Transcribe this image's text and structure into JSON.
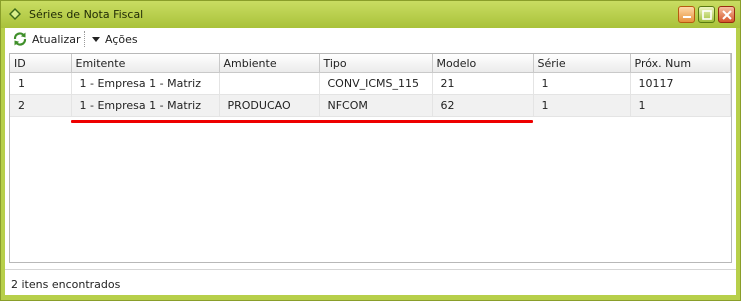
{
  "window": {
    "title": "Séries de Nota Fiscal",
    "accent": "#b7cf4a"
  },
  "toolbar": {
    "refresh_label": "Atualizar",
    "actions_label": "Ações"
  },
  "grid": {
    "columns": [
      "ID",
      "Emitente",
      "Ambiente",
      "Tipo",
      "Modelo",
      "Série",
      "Próx. Num"
    ],
    "rows": [
      [
        "1",
        "1 - Empresa 1 - Matriz",
        "",
        "CONV_ICMS_115",
        "21",
        "1",
        "10117"
      ],
      [
        "2",
        "1 - Empresa 1 - Matriz",
        "PRODUCAO",
        "NFCOM",
        "62",
        "1",
        "1"
      ]
    ]
  },
  "status": {
    "text": "2 itens encontrados"
  },
  "highlight_color": "#ee0000"
}
